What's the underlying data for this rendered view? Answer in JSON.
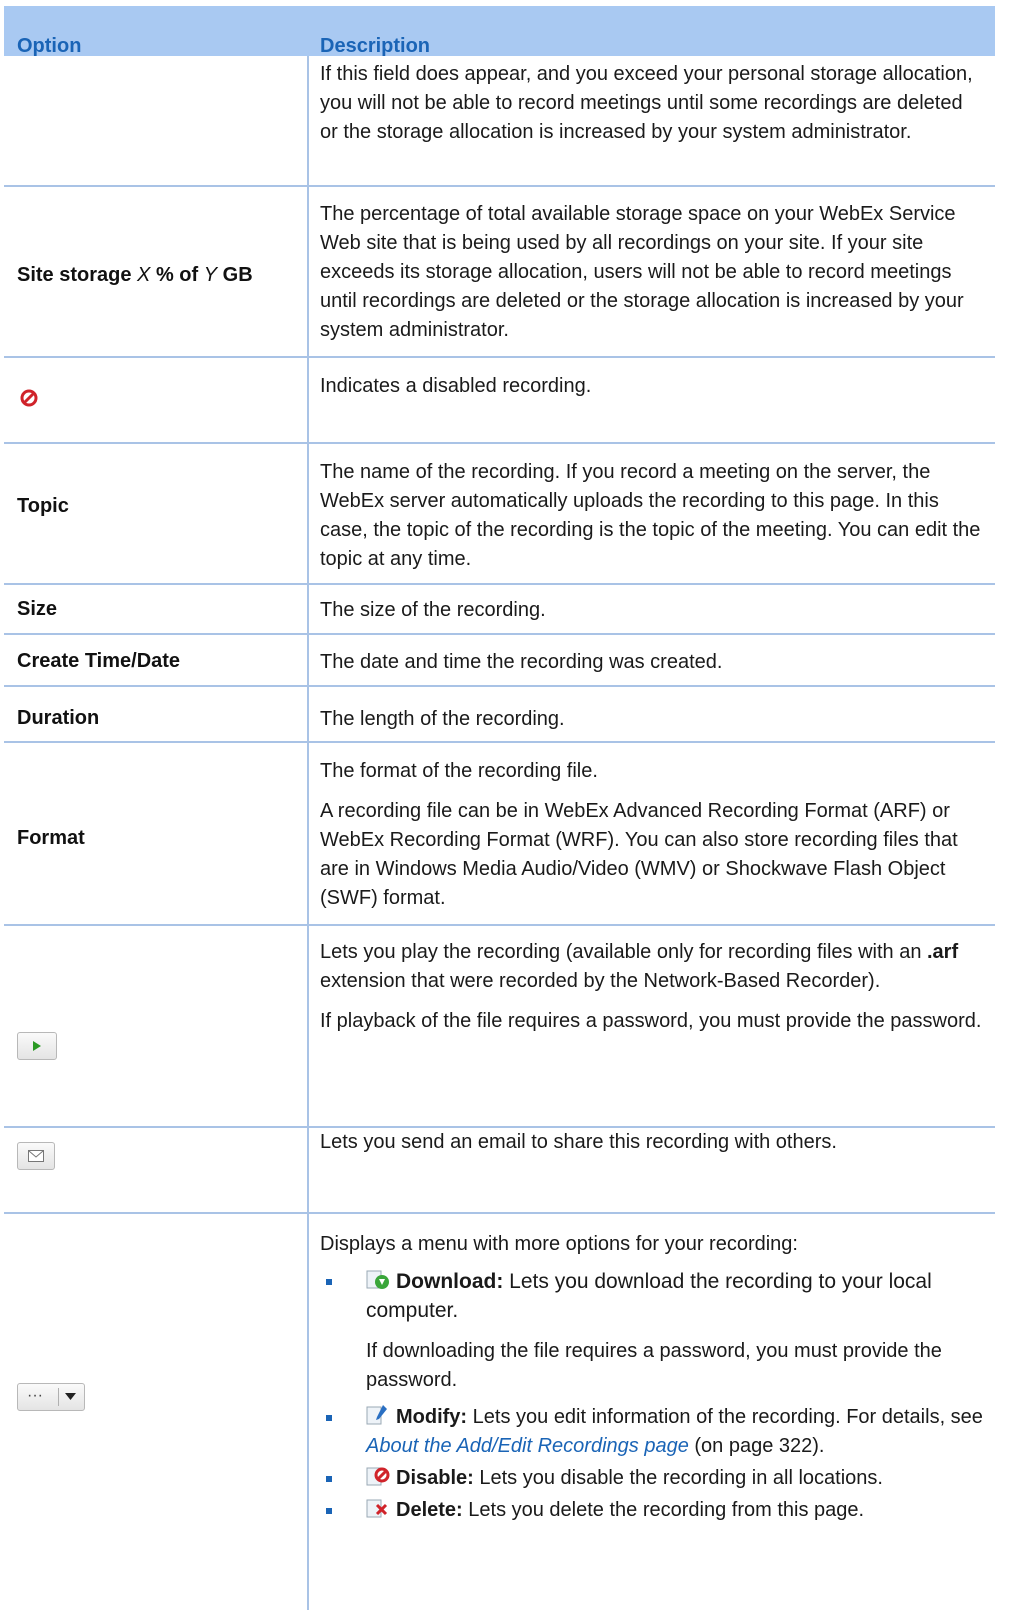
{
  "table": {
    "header": {
      "option": "Option",
      "description": "Description"
    },
    "rows": [
      {
        "option": "",
        "description": "If this field does appear, and you exceed your personal storage allocation, you will not be able to record meetings until some recordings are deleted or the storage allocation is increased by your system administrator."
      },
      {
        "option_parts": [
          "Site storage ",
          "X",
          " % of ",
          "Y",
          " GB"
        ],
        "description": "The percentage of total available storage space on your WebEx Service Web site that is being used by all recordings on your site. If your site exceeds its storage allocation, users will not be able to record meetings until recordings are deleted or the storage allocation is increased by your system administrator."
      },
      {
        "icon": "disabled-icon",
        "description": "Indicates a disabled recording."
      },
      {
        "option": "Topic",
        "description": "The name of the recording. If you record a meeting on the server, the WebEx server automatically uploads the recording to this page. In this case, the topic of the recording is the topic of the meeting. You can edit the topic at any time."
      },
      {
        "option": "Size",
        "description": "The size of the recording."
      },
      {
        "option": "Create Time/Date",
        "description": "The date and time the recording was created."
      },
      {
        "option": "Duration",
        "description": "The length of the recording."
      },
      {
        "option": "Format",
        "description": "The format of the recording file.",
        "description2": "A recording file can be in WebEx Advanced Recording Format (ARF) or WebEx Recording Format (WRF). You can also store recording files that are in Windows Media Audio/Video (WMV) or Shockwave Flash Object (SWF) format."
      },
      {
        "icon": "play-icon",
        "description_parts": [
          "Lets you play the recording (available only for recording files with an ",
          ".arf",
          " extension that were recorded by the Network-Based Recorder)."
        ],
        "description2": "If playback of the file requires a password, you must provide the password."
      },
      {
        "icon": "email-icon",
        "description": "Lets you send an email to share this recording with others."
      },
      {
        "icon": "more-menu-icon",
        "more_symbol": "···",
        "description": "Displays a menu with more options for your recording:",
        "items": [
          {
            "icon": "download-icon",
            "label": "Download:",
            "text": " Lets you download the recording to your local computer."
          },
          {
            "icon": "modify-icon",
            "label": "Modify:",
            "text_before": " Lets you edit information of the recording. For details, see ",
            "link": "About the Add/Edit Recordings page",
            "text_after": " (on page 322)."
          },
          {
            "icon": "disable-icon",
            "label": "Disable:",
            "text": " Lets you disable the recording in all locations."
          },
          {
            "icon": "delete-icon",
            "label": "Delete:",
            "text": " Lets you delete the recording from this page."
          }
        ],
        "download_note": "If downloading the file requires a password, you must provide the password."
      }
    ]
  },
  "colors": {
    "header_bg": "#a9c9f2",
    "header_text": "#1a64b6",
    "rule": "#a9c3e6",
    "link": "#1a64b6"
  }
}
